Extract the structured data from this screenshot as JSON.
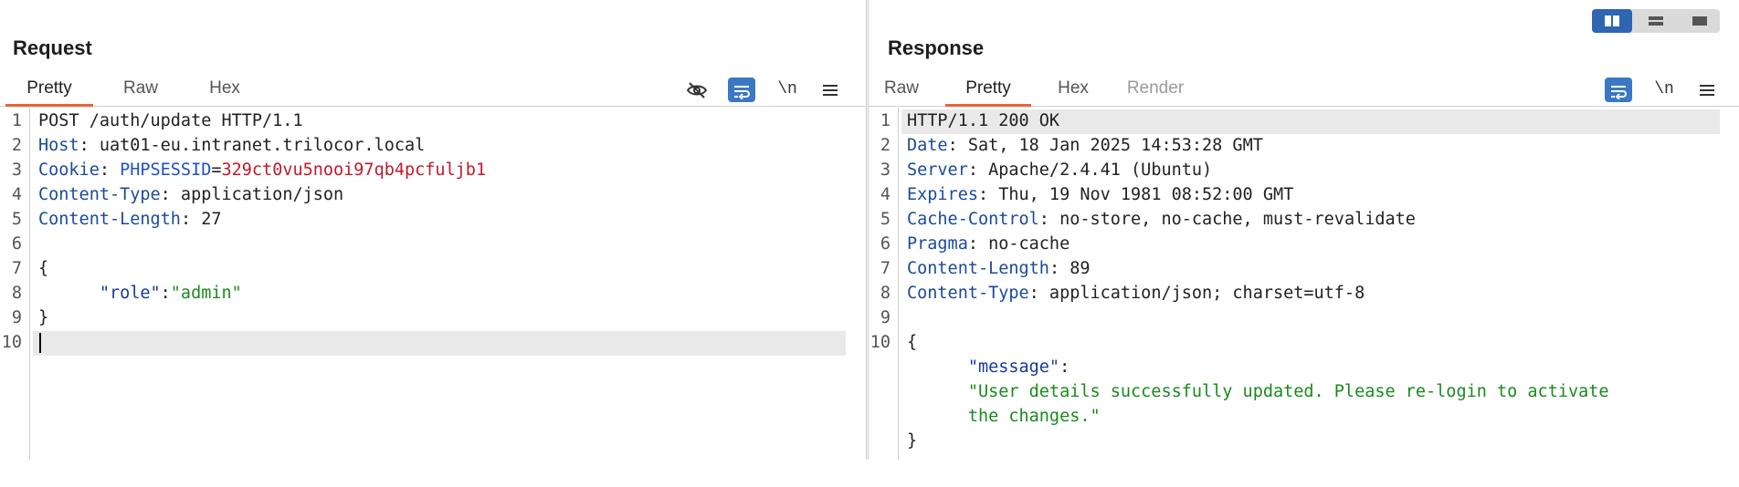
{
  "request": {
    "title": "Request",
    "tabs": [
      "Pretty",
      "Raw",
      "Hex"
    ],
    "active_tab": "Pretty",
    "tools": {
      "newline_label": "\\n"
    },
    "line_numbers": [
      "1",
      "2",
      "3",
      "4",
      "5",
      "6",
      "7",
      "8",
      "9",
      "10"
    ],
    "lines": {
      "l1": "POST /auth/update HTTP/1.1",
      "l2_key": "Host",
      "l2_val": " uat01-eu.intranet.trilocor.local",
      "l3_key": "Cookie",
      "l3_ckey": "PHPSESSID",
      "l3_eq": "=",
      "l3_cval": "329ct0vu5nooi97qb4pcfuljb1",
      "l4_key": "Content-Type",
      "l4_val": " application/json",
      "l5_key": "Content-Length",
      "l5_val": " 27",
      "l7": "{",
      "l8_key": "\"role\"",
      "l8_colon": ":",
      "l8_val": "\"admin\"",
      "l9": "}"
    }
  },
  "response": {
    "title": "Response",
    "tabs": [
      "Raw",
      "Pretty",
      "Hex",
      "Render"
    ],
    "active_tab": "Pretty",
    "disabled_tab": "Render",
    "tools": {
      "newline_label": "\\n"
    },
    "line_numbers": [
      "1",
      "2",
      "3",
      "4",
      "5",
      "6",
      "7",
      "8",
      "9",
      "10"
    ],
    "lines": {
      "l1": "HTTP/1.1 200 OK",
      "l2_key": "Date",
      "l2_val": " Sat, 18 Jan 2025 14:53:28 GMT",
      "l3_key": "Server",
      "l3_val": " Apache/2.4.41 (Ubuntu)",
      "l4_key": "Expires",
      "l4_val": " Thu, 19 Nov 1981 08:52:00 GMT",
      "l5_key": "Cache-Control",
      "l5_val": " no-store, no-cache, must-revalidate",
      "l6_key": "Pragma",
      "l6_val": " no-cache",
      "l7_key": "Content-Length",
      "l7_val": " 89",
      "l8_key": "Content-Type",
      "l8_val": " application/json; charset=utf-8",
      "l10": "{",
      "json_key": "\"message\"",
      "json_colon": ":",
      "json_val_1": "\"User details successfully updated. Please re-login to activate",
      "json_val_2": "the changes.\"",
      "close": "}"
    }
  },
  "layout_toggle": {
    "options": [
      "split-vertical",
      "split-horizontal",
      "single"
    ],
    "active": "split-vertical"
  },
  "colors": {
    "accent_tab": "#e8633a",
    "toggle_on": "#3b78c4",
    "header_key": "#1b4a9c",
    "cookie_value": "#c01a2a",
    "json_string": "#1a8a1e"
  }
}
